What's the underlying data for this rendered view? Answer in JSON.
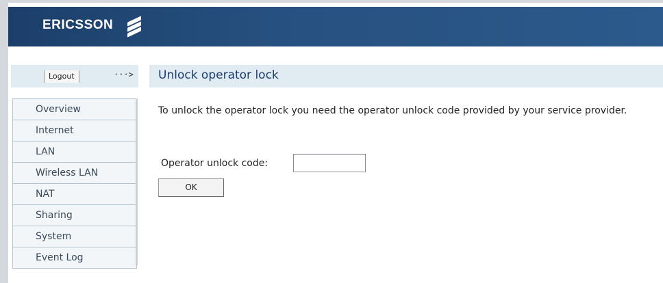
{
  "header": {
    "brand": "ERICSSON"
  },
  "top": {
    "logout_label": "Logout",
    "arrow": "···>"
  },
  "main": {
    "title": "Unlock operator lock",
    "intro": "To unlock the operator lock you need the operator unlock code provided by your service provider.",
    "field_label": "Operator unlock code:",
    "field_value": "",
    "ok_label": "OK"
  },
  "nav": {
    "items": [
      {
        "label": "Overview"
      },
      {
        "label": "Internet"
      },
      {
        "label": "LAN"
      },
      {
        "label": "Wireless LAN"
      },
      {
        "label": "NAT"
      },
      {
        "label": "Sharing"
      },
      {
        "label": "System"
      },
      {
        "label": "Event Log"
      }
    ]
  },
  "colors": {
    "header": "#26507f",
    "title": "#1d3d6e",
    "titlebar": "#e1ecf2",
    "nav_bg": "#f2f6f8"
  },
  "icons": {
    "logo": "ericsson-logo-icon",
    "arrow": "arrow-right-icon"
  }
}
